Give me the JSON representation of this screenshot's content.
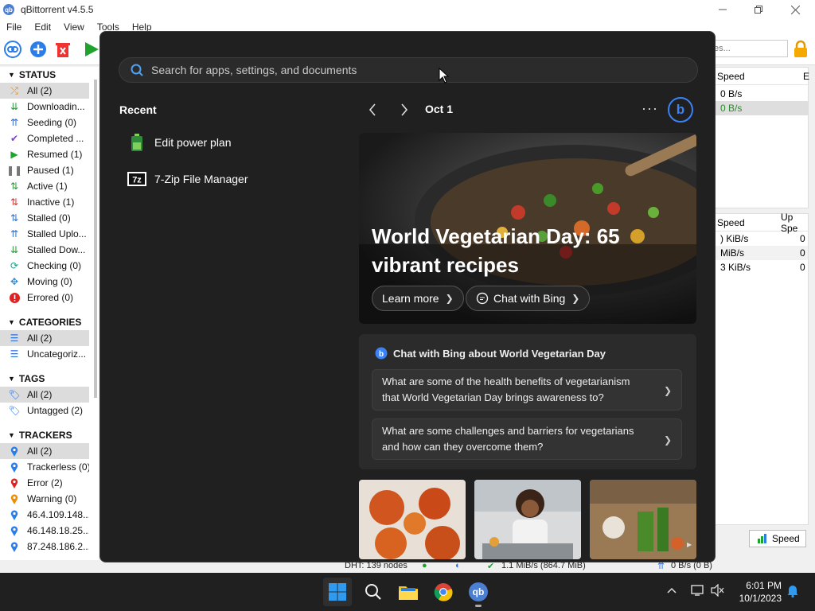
{
  "app": {
    "title": "qBittorrent v4.5.5",
    "logo_text": "qb",
    "menu": [
      "File",
      "Edit",
      "View",
      "Tools",
      "Help"
    ],
    "search_placeholder": "es..."
  },
  "sidebar": {
    "status_header": "STATUS",
    "status_items": [
      {
        "label": "All (2)",
        "icon": "shuffle-icon"
      },
      {
        "label": "Downloadin...",
        "icon": "download-icon"
      },
      {
        "label": "Seeding (0)",
        "icon": "upload-icon"
      },
      {
        "label": "Completed ...",
        "icon": "checkmark-icon"
      },
      {
        "label": "Resumed (1)",
        "icon": "play-icon"
      },
      {
        "label": "Paused (1)",
        "icon": "pause-icon"
      },
      {
        "label": "Active (1)",
        "icon": "active-arrows-icon"
      },
      {
        "label": "Inactive (1)",
        "icon": "inactive-arrows-icon"
      },
      {
        "label": "Stalled (0)",
        "icon": "stalled-arrows-icon"
      },
      {
        "label": "Stalled Uplo...",
        "icon": "stalled-upload-icon"
      },
      {
        "label": "Stalled Dow...",
        "icon": "stalled-download-icon"
      },
      {
        "label": "Checking (0)",
        "icon": "checking-icon"
      },
      {
        "label": "Moving (0)",
        "icon": "moving-icon"
      },
      {
        "label": "Errored (0)",
        "icon": "error-icon"
      }
    ],
    "categories_header": "CATEGORIES",
    "category_items": [
      {
        "label": "All (2)",
        "icon": "list-icon"
      },
      {
        "label": "Uncategoriz...",
        "icon": "list-icon"
      }
    ],
    "tags_header": "TAGS",
    "tag_items": [
      {
        "label": "All (2)",
        "icon": "tag-icon"
      },
      {
        "label": "Untagged (2)",
        "icon": "tag-icon"
      }
    ],
    "trackers_header": "TRACKERS",
    "tracker_items": [
      {
        "label": "All (2)",
        "icon": "pin-icon"
      },
      {
        "label": "Trackerless (0)",
        "icon": "pin-icon"
      },
      {
        "label": "Error (2)",
        "icon": "pin-error-icon"
      },
      {
        "label": "Warning (0)",
        "icon": "pin-warning-icon"
      },
      {
        "label": "46.4.109.148....",
        "icon": "pin-icon"
      },
      {
        "label": "46.148.18.25....",
        "icon": "pin-icon"
      },
      {
        "label": "87.248.186.2....",
        "icon": "pin-icon"
      }
    ]
  },
  "right_panel": {
    "top_header": "Speed",
    "top_header_edge": "E",
    "top_rows": [
      "0 B/s",
      "0 B/s"
    ],
    "bottom_header_a": "Speed",
    "bottom_header_b": "Up Spe",
    "bottom_rows": [
      {
        "a": ") KiB/s",
        "b": "0"
      },
      {
        "a": "MiB/s",
        "b": "0"
      },
      {
        "a": "3 KiB/s",
        "b": "0"
      }
    ],
    "speed_button": "Speed"
  },
  "statusbar": {
    "dht": "DHT: 139 nodes",
    "download": "1.1 MiB/s (864.7 MiB)",
    "upload": "0 B/s (0 B)"
  },
  "start_menu": {
    "search_placeholder": "Search for apps, settings, and documents",
    "recent_title": "Recent",
    "recent_items": [
      {
        "label": "Edit power plan",
        "icon": "battery-icon"
      },
      {
        "label": "7-Zip File Manager",
        "icon": "7zip-icon"
      }
    ],
    "date": "Oct 1",
    "more": "···",
    "bing_logo": "b",
    "hero": {
      "title": "World Vegetarian Day: 65 vibrant recipes",
      "learn_more": "Learn more",
      "chat_with_bing": "Chat with Bing"
    },
    "chat": {
      "heading": "Chat with Bing about World Vegetarian Day",
      "questions": [
        "What are some of the health benefits of vegetarianism that World Vegetarian Day brings awareness to?",
        "What are some challenges and barriers for vegetarians and how can they overcome them?"
      ]
    }
  },
  "taskbar": {
    "time": "6:01 PM",
    "date": "10/1/2023",
    "qb_label": "qb"
  },
  "colors": {
    "start_bg": "#202020",
    "bing_blue": "#3b82f6",
    "taskbar_bg": "#202020"
  }
}
